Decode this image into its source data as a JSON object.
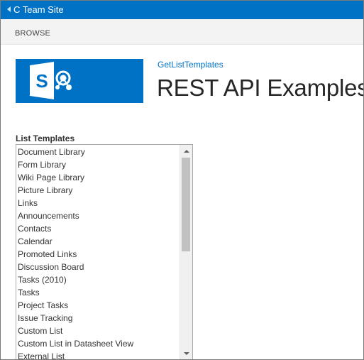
{
  "suitebar": {
    "site_title": "C Team Site",
    "color": "#0072c6"
  },
  "ribbon": {
    "tab_browse": "BROWSE"
  },
  "header": {
    "breadcrumb_link": "GetListTemplates",
    "page_title": "REST API Examples",
    "logo_icon": "sharepoint-logo-icon"
  },
  "main": {
    "list_label": "List Templates",
    "list_items": [
      "Document Library",
      "Form Library",
      "Wiki Page Library",
      "Picture Library",
      "Links",
      "Announcements",
      "Contacts",
      "Calendar",
      "Promoted Links",
      "Discussion Board",
      "Tasks (2010)",
      "Tasks",
      "Project Tasks",
      "Issue Tracking",
      "Custom List",
      "Custom List in Datasheet View",
      "External List"
    ]
  }
}
